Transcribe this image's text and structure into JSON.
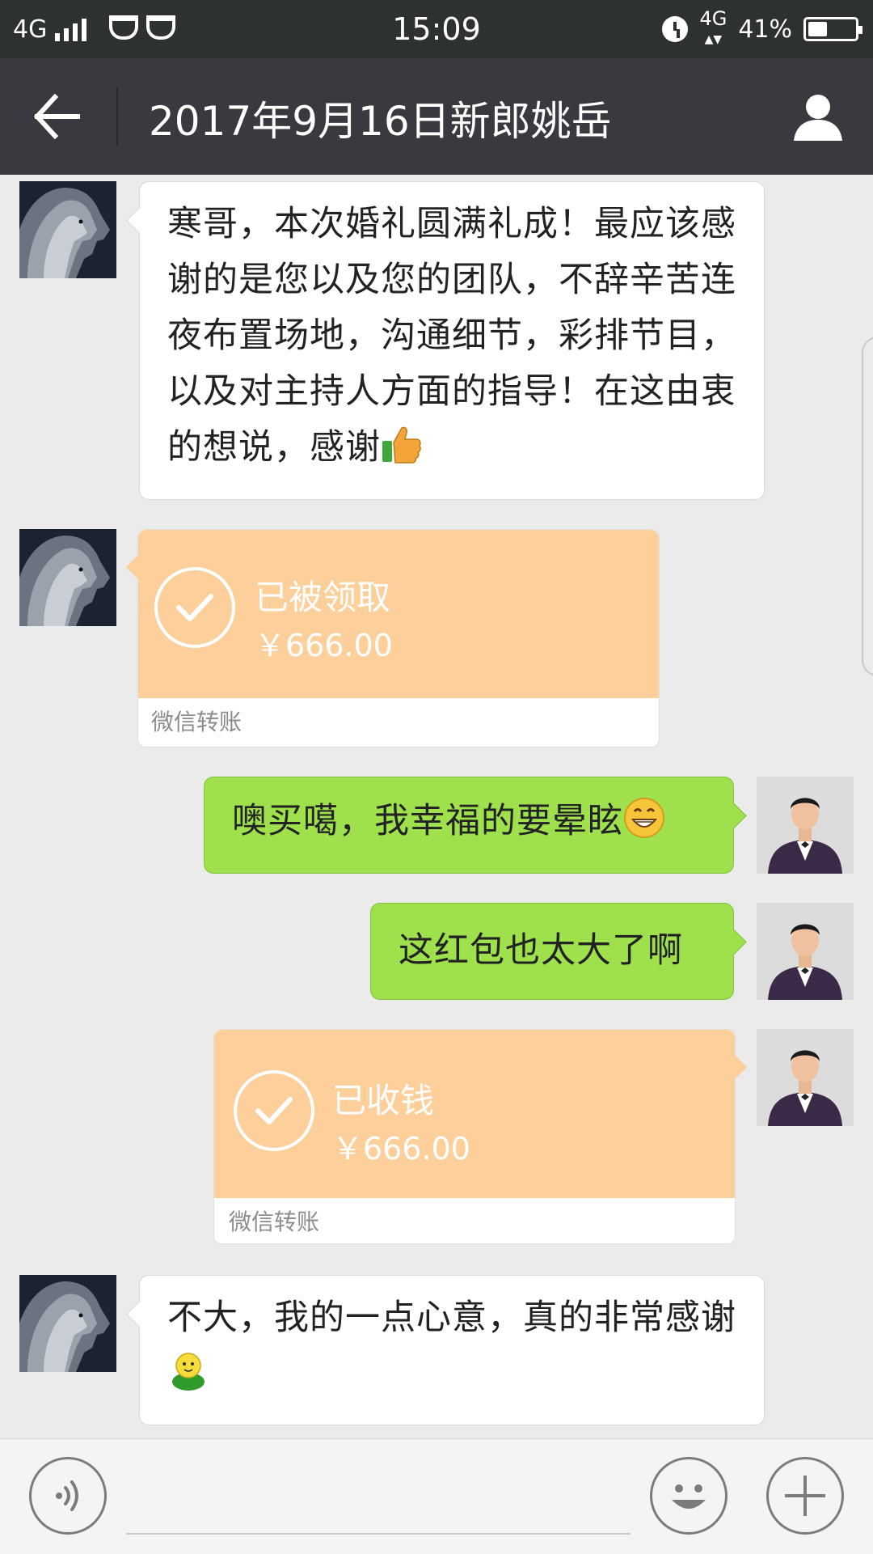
{
  "status_bar": {
    "network_left": "4G",
    "time": "15:09",
    "network_right": "4G",
    "battery": "41%",
    "battery_level": 0.41
  },
  "header": {
    "title": "2017年9月16日新郎姚岳"
  },
  "messages": [
    {
      "direction": "in",
      "type": "text",
      "text": "寒哥，本次婚礼圆满礼成！最应该感谢的是您以及您的团队，不辞辛苦连夜布置场地，沟通细节，彩排节目，以及对主持人方面的指导！在这由衷的想说，感谢",
      "emoji": "thumbs-up-emoji"
    },
    {
      "direction": "in",
      "type": "transfer",
      "status": "已被领取",
      "amount": "￥666.00",
      "label": "微信转账"
    },
    {
      "direction": "out",
      "type": "text",
      "text": "噢买噶，我幸福的要晕眩",
      "emoji": "grin-emoji"
    },
    {
      "direction": "out",
      "type": "text",
      "text": "这红包也太大了啊"
    },
    {
      "direction": "out",
      "type": "transfer",
      "status": "已收钱",
      "amount": "￥666.00",
      "label": "微信转账"
    },
    {
      "direction": "in",
      "type": "text",
      "text": "不大，我的一点心意，真的非常感谢",
      "emoji": "doll-emoji"
    }
  ],
  "colors": {
    "status_bar": "#2e3132",
    "header": "#393a3f",
    "chat_bg": "#ebebeb",
    "bubble_out": "#9ee14d",
    "transfer": "#fdcf9a"
  }
}
